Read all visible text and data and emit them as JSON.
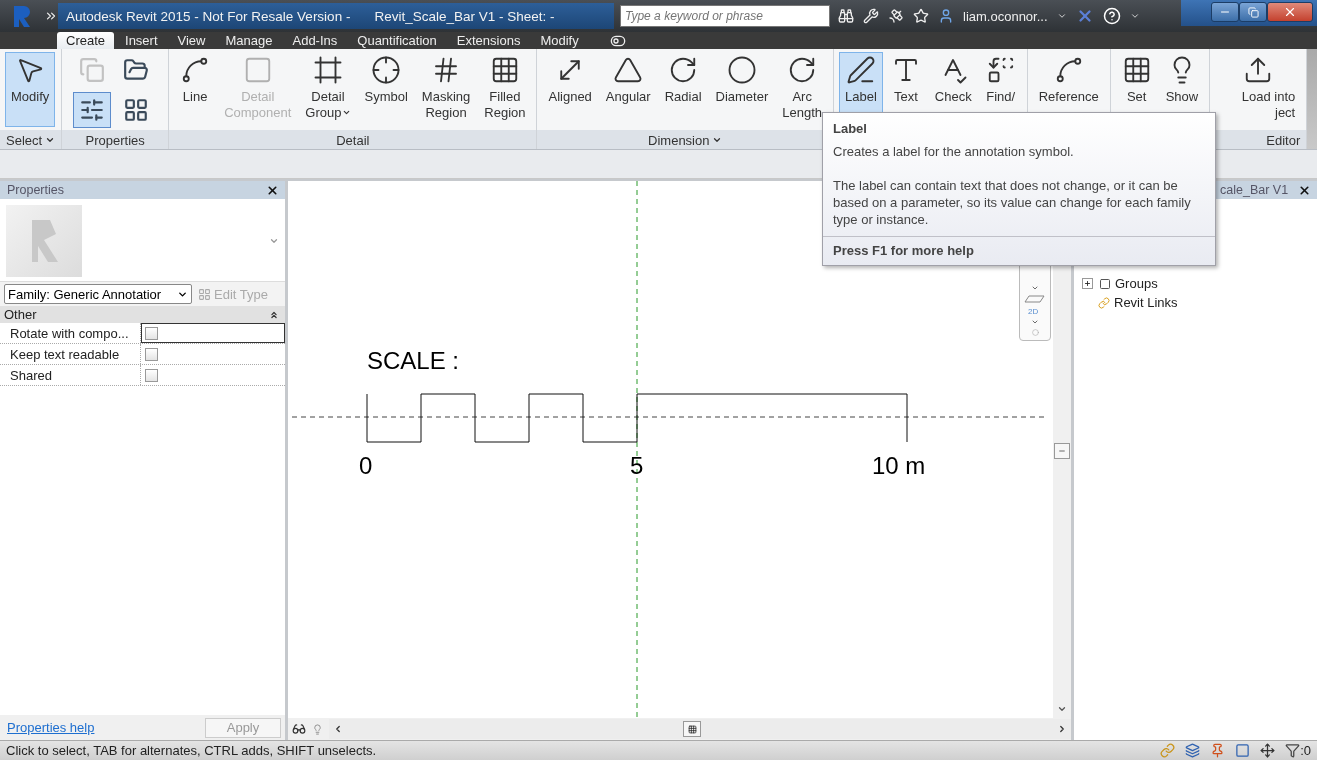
{
  "title_bar": {
    "title": "Autodesk Revit 2015 - Not For Resale Version -",
    "document": "Revit_Scale_Bar V1 - Sheet: -",
    "search": {
      "placeholder": "Type a keyword or phrase"
    },
    "user": "liam.oconnor..."
  },
  "tabs": [
    {
      "label": "Create",
      "selected": true
    },
    {
      "label": "Insert",
      "selected": false
    },
    {
      "label": "View",
      "selected": false
    },
    {
      "label": "Manage",
      "selected": false
    },
    {
      "label": "Add-Ins",
      "selected": false
    },
    {
      "label": "Quantification",
      "selected": false
    },
    {
      "label": "Extensions",
      "selected": false
    },
    {
      "label": "Modify",
      "selected": false
    }
  ],
  "ribbon": {
    "panels": [
      {
        "label": "Select",
        "menu": true,
        "tools": [
          {
            "kind": "large",
            "lines": [
              "Modify"
            ],
            "selected": true,
            "disabled": false
          }
        ]
      },
      {
        "label": "Properties",
        "tools": [
          {
            "kind": "small",
            "selected": false,
            "disabled": true
          },
          {
            "kind": "small",
            "selected": false,
            "disabled": false
          },
          {
            "kind": "small",
            "selected": true,
            "disabled": false
          },
          {
            "kind": "small",
            "selected": false,
            "disabled": false
          }
        ]
      },
      {
        "label": "Detail",
        "tools": [
          {
            "kind": "large",
            "lines": [
              "Line"
            ],
            "selected": false,
            "disabled": false
          },
          {
            "kind": "large",
            "lines": [
              "Detail",
              "Component"
            ],
            "selected": false,
            "disabled": true
          },
          {
            "kind": "large",
            "lines": [
              "Detail",
              "Group"
            ],
            "selected": false,
            "disabled": false,
            "menu": true
          },
          {
            "kind": "large",
            "lines": [
              "Symbol"
            ],
            "selected": false,
            "disabled": false
          },
          {
            "kind": "large",
            "lines": [
              "Masking",
              "Region"
            ],
            "selected": false,
            "disabled": false
          },
          {
            "kind": "large",
            "lines": [
              "Filled",
              "Region"
            ],
            "selected": false,
            "disabled": false
          }
        ]
      },
      {
        "label": "Dimension",
        "menu": true,
        "tools": [
          {
            "kind": "large",
            "lines": [
              "Aligned"
            ],
            "selected": false,
            "disabled": false
          },
          {
            "kind": "large",
            "lines": [
              "Angular"
            ],
            "selected": false,
            "disabled": false
          },
          {
            "kind": "large",
            "lines": [
              "Radial"
            ],
            "selected": false,
            "disabled": false
          },
          {
            "kind": "large",
            "lines": [
              "Diameter"
            ],
            "selected": false,
            "disabled": false
          },
          {
            "kind": "large",
            "lines": [
              "Arc",
              "Length"
            ],
            "selected": false,
            "disabled": false
          }
        ]
      },
      {
        "tools": [
          {
            "kind": "large",
            "lines": [
              "Label"
            ],
            "selected": true,
            "disabled": false
          },
          {
            "kind": "large",
            "lines": [
              "Text"
            ],
            "selected": false,
            "disabled": false
          },
          {
            "kind": "large",
            "lines": [
              "Check"
            ],
            "selected": false,
            "disabled": false
          },
          {
            "kind": "large",
            "lines": [
              "Find/"
            ],
            "selected": false,
            "disabled": false
          }
        ]
      },
      {
        "tools": [
          {
            "kind": "large",
            "lines": [
              "Reference"
            ],
            "selected": false,
            "disabled": false
          }
        ]
      },
      {
        "tools": [
          {
            "kind": "large",
            "lines": [
              "Set"
            ],
            "selected": false,
            "disabled": false
          },
          {
            "kind": "large",
            "lines": [
              "Show"
            ],
            "selected": false,
            "disabled": false
          }
        ]
      },
      {
        "label": "Editor",
        "tools": [
          {
            "kind": "large",
            "lines": [
              "Load into",
              "ject"
            ],
            "selected": false,
            "disabled": false
          }
        ]
      }
    ]
  },
  "properties": {
    "title": "Properties",
    "type_selector": "Family: Generic Annotatior",
    "edit_type": "Edit Type",
    "group": "Other",
    "rows": [
      {
        "name": "Rotate with compo...",
        "checked": false,
        "focused": true
      },
      {
        "name": "Keep text readable",
        "checked": false,
        "focused": false
      },
      {
        "name": "Shared",
        "checked": false,
        "focused": false
      }
    ],
    "help_link": "Properties help",
    "apply": "Apply"
  },
  "canvas": {
    "heading": "SCALE :",
    "ticks": [
      "0",
      "5",
      "10 m"
    ],
    "nav_label": "2D"
  },
  "browser": {
    "title": "cale_Bar V1",
    "items": [
      {
        "label": "Groups",
        "expandable": true
      },
      {
        "label": "Revit Links",
        "expandable": false
      }
    ]
  },
  "tooltip": {
    "title": "Label",
    "description": "Creates a label for the annotation symbol.",
    "details": "The label can contain text that does not change, or it can be based on a parameter, so its value can change for each family type or instance.",
    "help": "Press F1 for more help"
  },
  "status_bar": {
    "message": "Click to select, TAB for alternates, CTRL adds, SHIFT unselects.",
    "filter_count": ":0"
  }
}
